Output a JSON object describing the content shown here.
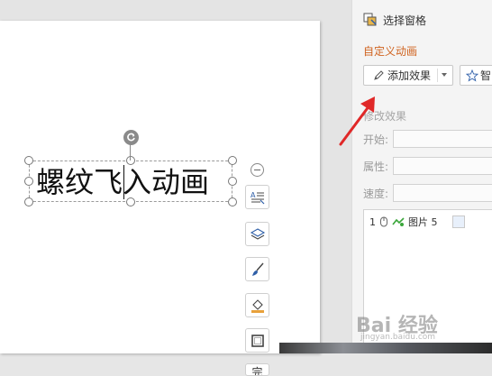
{
  "slide": {
    "textbox_text": "螺纹飞入动画"
  },
  "quick_toolbar": {
    "buttons": [
      "text-wrap-icon",
      "layers-icon",
      "brush-icon",
      "fill-icon",
      "border-icon",
      "more"
    ],
    "partial_label": "完"
  },
  "pane": {
    "title": "选择窗格",
    "section_title": "自定义动画",
    "add_effect_label": "添加效果",
    "smart_label": "智",
    "modify_label": "修改效果",
    "start_label": "开始:",
    "property_label": "属性:",
    "speed_label": "速度:",
    "animation_list": [
      {
        "index": "1",
        "name": "图片 5"
      }
    ]
  },
  "colors": {
    "accent_orange": "#d0631f",
    "arrow_red": "#e02828"
  },
  "watermark": {
    "brand": "Bai 经验",
    "url": "jingyan.baidu.com"
  }
}
